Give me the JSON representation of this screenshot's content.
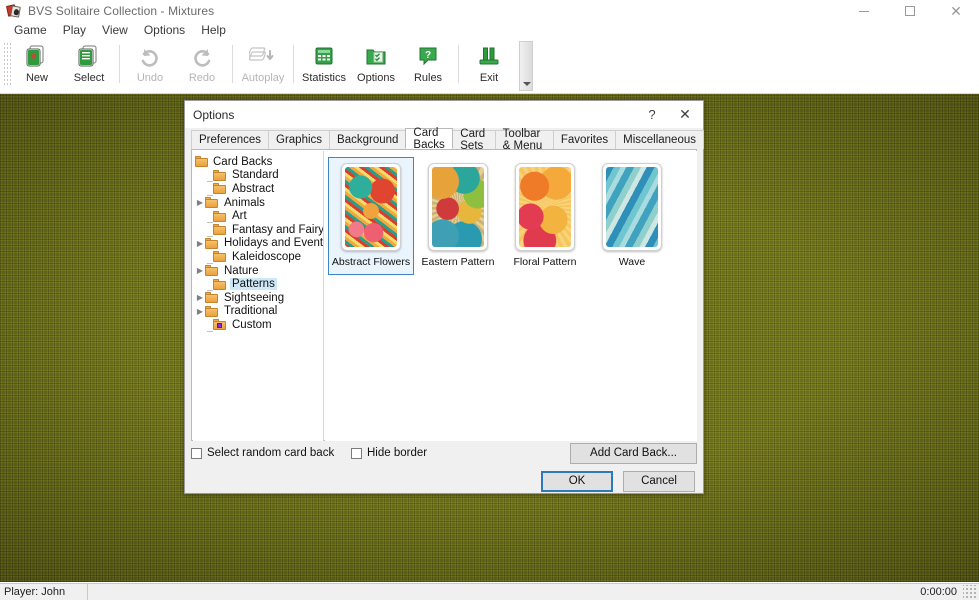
{
  "window": {
    "icon": "cards-icon",
    "title": "BVS Solitaire Collection  -  Mixtures",
    "minimize": "minimize-icon",
    "maximize": "maximize-icon",
    "close": "close-icon"
  },
  "menubar": {
    "items": [
      {
        "label": "Game"
      },
      {
        "label": "Play"
      },
      {
        "label": "View"
      },
      {
        "label": "Options"
      },
      {
        "label": "Help"
      }
    ]
  },
  "toolbar": {
    "buttons": [
      {
        "label": "New",
        "icon": "new-game-icon",
        "enabled": true
      },
      {
        "label": "Select",
        "icon": "select-game-icon",
        "enabled": true
      },
      {
        "label": "Undo",
        "icon": "undo-icon",
        "enabled": false
      },
      {
        "label": "Redo",
        "icon": "redo-icon",
        "enabled": false
      },
      {
        "label": "Autoplay",
        "icon": "autoplay-icon",
        "enabled": false
      },
      {
        "label": "Statistics",
        "icon": "statistics-icon",
        "enabled": true
      },
      {
        "label": "Options",
        "icon": "options-icon",
        "enabled": true
      },
      {
        "label": "Rules",
        "icon": "rules-icon",
        "enabled": true
      },
      {
        "label": "Exit",
        "icon": "exit-icon",
        "enabled": true
      }
    ],
    "overflow": "toolbar-overflow-icon"
  },
  "dialog": {
    "title": "Options",
    "help_button": "?",
    "close_button": "✕",
    "tabs": [
      {
        "label": "Preferences",
        "active": false
      },
      {
        "label": "Graphics",
        "active": false
      },
      {
        "label": "Background",
        "active": false
      },
      {
        "label": "Card Backs",
        "active": true
      },
      {
        "label": "Card Sets",
        "active": false
      },
      {
        "label": "Toolbar & Menu",
        "active": false
      },
      {
        "label": "Favorites",
        "active": false
      },
      {
        "label": "Miscellaneous",
        "active": false
      }
    ],
    "tree": {
      "nodes": [
        {
          "label": "Card Backs",
          "level": 0,
          "expander": "down",
          "selected": false,
          "icon": "folder-open-icon"
        },
        {
          "label": "Standard",
          "level": 1,
          "expander": "none",
          "selected": false,
          "icon": "folder-icon"
        },
        {
          "label": "Abstract",
          "level": 1,
          "expander": "none",
          "selected": false,
          "icon": "folder-icon"
        },
        {
          "label": "Animals",
          "level": 1,
          "expander": "right",
          "selected": false,
          "icon": "folder-icon"
        },
        {
          "label": "Art",
          "level": 1,
          "expander": "none",
          "selected": false,
          "icon": "folder-icon"
        },
        {
          "label": "Fantasy and Fairy Tales",
          "level": 1,
          "expander": "none",
          "selected": false,
          "icon": "folder-icon"
        },
        {
          "label": "Holidays and Events",
          "level": 1,
          "expander": "right",
          "selected": false,
          "icon": "folder-icon"
        },
        {
          "label": "Kaleidoscope",
          "level": 1,
          "expander": "none",
          "selected": false,
          "icon": "folder-icon"
        },
        {
          "label": "Nature",
          "level": 1,
          "expander": "right",
          "selected": false,
          "icon": "folder-icon"
        },
        {
          "label": "Patterns",
          "level": 1,
          "expander": "none",
          "selected": true,
          "icon": "folder-open-icon"
        },
        {
          "label": "Sightseeing",
          "level": 1,
          "expander": "right",
          "selected": false,
          "icon": "folder-icon"
        },
        {
          "label": "Traditional",
          "level": 1,
          "expander": "right",
          "selected": false,
          "icon": "folder-icon"
        },
        {
          "label": "Custom",
          "level": 1,
          "expander": "none",
          "selected": false,
          "icon": "folder-custom-icon"
        }
      ]
    },
    "card_backs": [
      {
        "name": "Abstract Flowers",
        "art": "art-abstract",
        "selected": true
      },
      {
        "name": "Eastern Pattern",
        "art": "art-eastern",
        "selected": false
      },
      {
        "name": "Floral Pattern",
        "art": "art-floral",
        "selected": false
      },
      {
        "name": "Wave",
        "art": "art-wave",
        "selected": false
      }
    ],
    "options": {
      "random_card_back_label": "Select random card back",
      "random_card_back_checked": false,
      "hide_border_label": "Hide border",
      "hide_border_checked": false,
      "add_card_back_label": "Add Card Back..."
    },
    "footer": {
      "ok_label": "OK",
      "cancel_label": "Cancel"
    }
  },
  "statusbar": {
    "player": "Player: John",
    "timer": "0:00:00",
    "grip": "resize-grip-icon"
  },
  "colors": {
    "accent": "#2e7ab8",
    "selection_bg": "#cde8f7",
    "table_green": "#6e7215",
    "toolbar_green": "#3c9a3c"
  }
}
